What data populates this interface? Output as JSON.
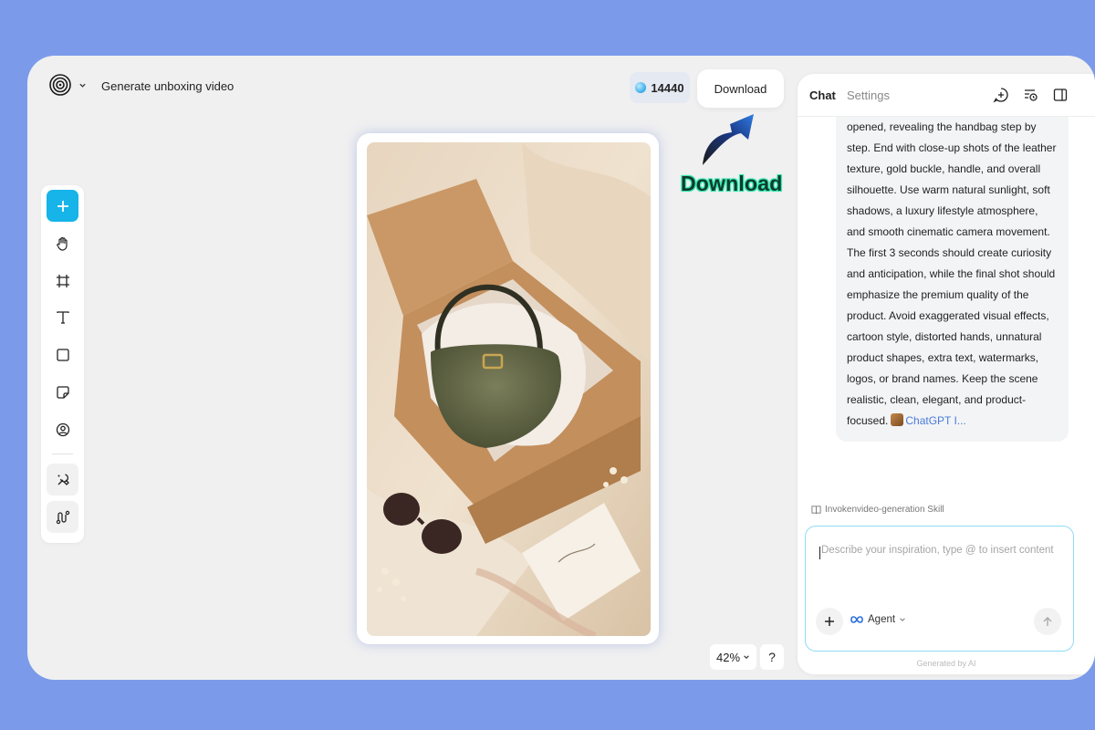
{
  "header": {
    "logo_icon": "spiral-logo-icon",
    "project_title": "Generate unboxing video",
    "credits": "14440",
    "download_label": "Download"
  },
  "annotation": {
    "text": "Download",
    "color": "#2ee0a8"
  },
  "toolbar": {
    "items": [
      {
        "icon": "plus-icon",
        "active": true
      },
      {
        "icon": "hand-icon"
      },
      {
        "icon": "frame-icon"
      },
      {
        "icon": "text-icon"
      },
      {
        "icon": "rectangle-icon"
      },
      {
        "icon": "sticky-note-icon"
      },
      {
        "icon": "avatar-icon"
      },
      {
        "icon": "magic-brush-icon"
      },
      {
        "icon": "path-icon"
      }
    ],
    "accent_color": "#16b4e8"
  },
  "canvas": {
    "zoom": "42%",
    "help": "?"
  },
  "panel": {
    "tabs": {
      "chat": "Chat",
      "settings": "Settings"
    },
    "message_text": "opened, revealing the handbag step by step. End with close-up shots of the leather texture, gold buckle, handle, and overall silhouette. Use warm natural sunlight, soft shadows, a luxury lifestyle atmosphere, and smooth cinematic camera movement. The first 3 seconds should create curiosity and anticipation, while the final shot should emphasize the premium quality of the product. Avoid exaggerated visual effects, cartoon style, distorted hands, unnatural product shapes, extra text, watermarks, logos, or brand names. Keep the scene realistic, clean, elegant, and product-focused.",
    "message_chip": "ChatGPT I...",
    "skill_label": "Invokenvideo-generation Skill",
    "input": {
      "placeholder": "Describe your inspiration, type @ to insert content",
      "value": ""
    },
    "agent_label": "Agent",
    "footer": "Generated by AI"
  }
}
